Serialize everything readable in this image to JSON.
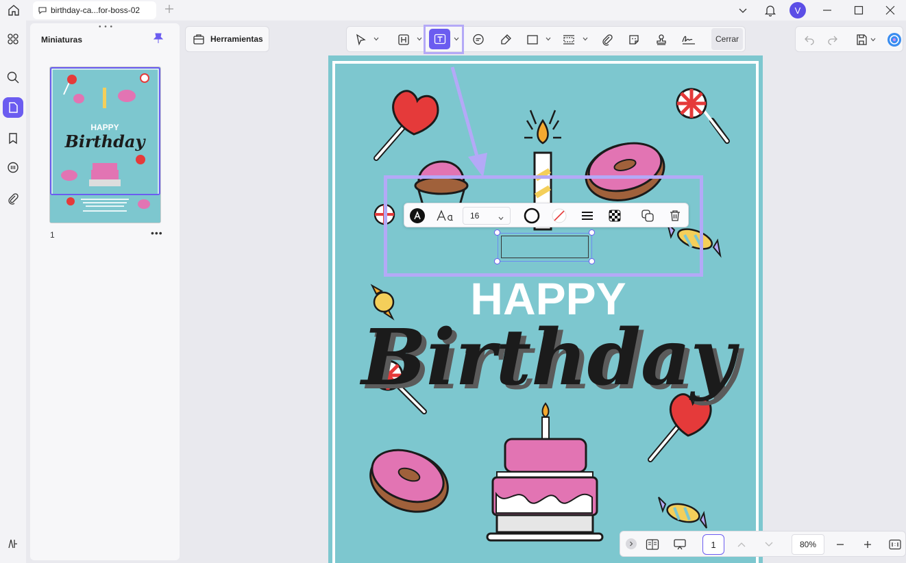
{
  "titlebar": {
    "tab_title": "birthday-ca...for-boss-02",
    "avatar_letter": "V"
  },
  "sidebar": {
    "panel_title": "Miniaturas",
    "grip": "• • •",
    "page_label": "1",
    "more": "•••"
  },
  "toolbar": {
    "tools_label": "Herramientas",
    "close_label": "Cerrar"
  },
  "format_bar": {
    "font_size": "16"
  },
  "document": {
    "happy_text": "HAPPY",
    "birthday_text": "Birthday"
  },
  "bottombar": {
    "page_value": "1",
    "zoom_value": "80%"
  },
  "colors": {
    "accent": "#6b5cf0",
    "highlight": "#b4a9f7",
    "card_bg": "#7dc7cf"
  }
}
